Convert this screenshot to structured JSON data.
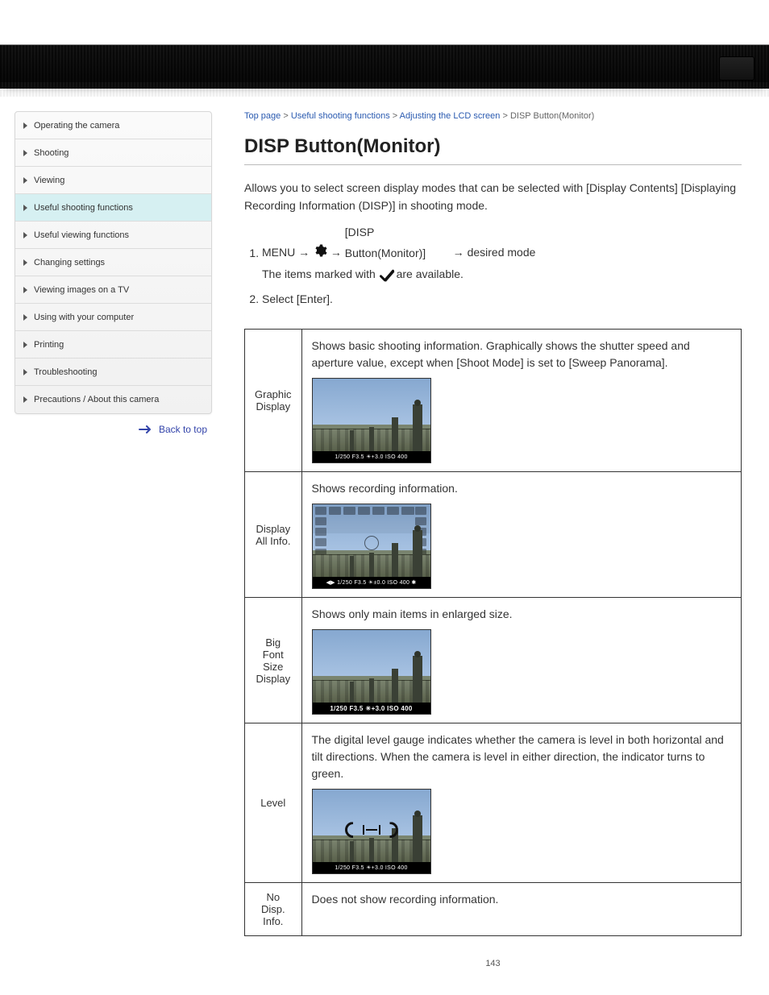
{
  "sidebar": {
    "items": [
      {
        "label": "Operating the camera"
      },
      {
        "label": "Shooting"
      },
      {
        "label": "Viewing"
      },
      {
        "label": "Useful shooting functions"
      },
      {
        "label": "Useful viewing functions"
      },
      {
        "label": "Changing settings"
      },
      {
        "label": "Viewing images on a TV"
      },
      {
        "label": "Using with your computer"
      },
      {
        "label": "Printing"
      },
      {
        "label": "Troubleshooting"
      },
      {
        "label": "Precautions / About this camera"
      }
    ],
    "active_index": 3,
    "back_to_top": "Back to top"
  },
  "breadcrumbs": [
    "Top page",
    "Useful shooting functions",
    "Adjusting the LCD screen",
    "DISP Button(Monitor)"
  ],
  "title": "DISP Button(Monitor)",
  "intro": "Allows you to select screen display modes that can be selected with [Display Contents] [Displaying Recording Information (DISP)] in shooting mode.",
  "steps": {
    "s1_pre": "MENU ",
    "s1_mid": " [DISP Button(Monitor)] ",
    "s1_post": " desired mode",
    "s1_note_a": "The items marked with ",
    "s1_note_b": " are available.",
    "s2": "Select [Enter]."
  },
  "table": {
    "rows": [
      {
        "key": "Graphic Display",
        "desc": "Shows basic shooting information. Graphically shows the shutter speed and aperture value, except when [Shoot Mode] is set to [Sweep Panorama].",
        "info_strip": "1/250  F3.5  ☀+3.0  ISO 400"
      },
      {
        "key": "Display All Info.",
        "desc": "Shows recording information.",
        "info_strip": "◀▶ 1/250  F3.5  ☀±0.0  ISO 400  ✱"
      },
      {
        "key": "Big Font Size Display",
        "desc": "Shows only main items in enlarged size.",
        "info_strip": "1/250   F3.5  ☀+3.0  ISO 400"
      },
      {
        "key": "Level",
        "desc": "The digital level gauge indicates whether the camera is level in both horizontal and tilt directions. When the camera is level in either direction, the indicator turns to green.",
        "info_strip": "1/250  F3.5  ☀+3.0  ISO 400"
      },
      {
        "key": "No Disp. Info.",
        "desc": "Does not show recording information.",
        "info_strip": ""
      }
    ]
  },
  "page_number": "143"
}
